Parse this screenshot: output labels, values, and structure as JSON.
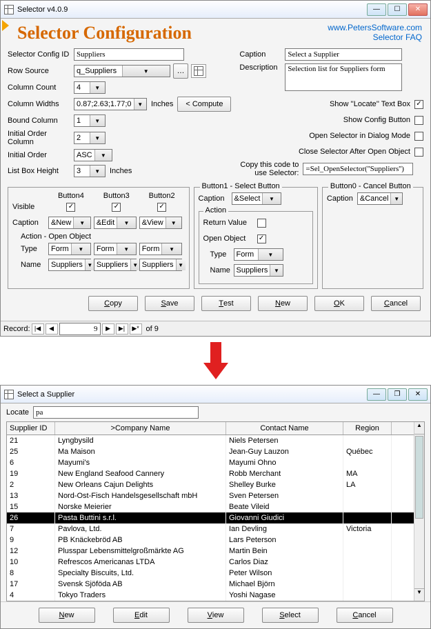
{
  "win1": {
    "title": "Selector v4.0.9",
    "heading": "Selector Configuration",
    "links": {
      "site": "www.PetersSoftware.com",
      "faq": "Selector FAQ"
    },
    "labels": {
      "config_id": "Selector Config ID",
      "row_source": "Row Source",
      "column_count": "Column Count",
      "column_widths": "Column Widths",
      "bound_column": "Bound Column",
      "initial_order_col": "Initial Order Column",
      "initial_order": "Initial Order",
      "list_box_height": "List Box Height",
      "caption": "Caption",
      "description": "Description",
      "inches": "Inches",
      "compute": "< Compute",
      "show_locate": "Show ''Locate'' Text Box",
      "show_config": "Show Config Button",
      "open_dialog": "Open Selector in Dialog Mode",
      "close_after": "Close Selector After Open Object",
      "copy_code": "Copy this code to use Selector:",
      "visible": "Visible",
      "caption2": "Caption",
      "action_open": "Action - Open Object",
      "type": "Type",
      "name": "Name",
      "button4": "Button4",
      "button3": "Button3",
      "button2": "Button2",
      "button1": "Button1 - Select Button",
      "button0": "Button0 - Cancel Button",
      "action": "Action",
      "return_value": "Return Value",
      "open_object": "Open Object"
    },
    "values": {
      "config_id": "Suppliers",
      "row_source": "q_Suppliers",
      "column_count": "4",
      "column_widths": "0.87;2.63;1.77;0",
      "bound_column": "1",
      "initial_order_col": "2",
      "initial_order": "ASC",
      "list_box_height": "3",
      "caption": "Select a Supplier",
      "description": "Selection list for Suppliers form",
      "copy_code": "=Sel_OpenSelector(''Suppliers'')",
      "btn4_caption": "&New",
      "btn3_caption": "&Edit",
      "btn2_caption": "&View",
      "btn1_caption": "&Select",
      "btn0_caption": "&Cancel",
      "type": "Form",
      "name": "Suppliers"
    },
    "checks": {
      "show_locate": true,
      "show_config": false,
      "open_dialog": false,
      "close_after": false,
      "vis4": true,
      "vis3": true,
      "vis2": true,
      "return_value": false,
      "open_object": true
    },
    "actions": {
      "copy": "Copy",
      "save": "Save",
      "test": "Test",
      "new": "New",
      "ok": "OK",
      "cancel": "Cancel"
    },
    "record": {
      "label": "Record:",
      "value": "9",
      "of": "of  9"
    }
  },
  "win2": {
    "title": "Select a Supplier",
    "locate_label": "Locate",
    "locate_value": "pa",
    "columns": {
      "id": "Supplier ID",
      "company": ">Company Name",
      "contact": "Contact Name",
      "region": "Region"
    },
    "rows": [
      {
        "id": "21",
        "company": "Lyngbysild",
        "contact": "Niels Petersen",
        "region": ""
      },
      {
        "id": "25",
        "company": "Ma Maison",
        "contact": "Jean-Guy Lauzon",
        "region": "Québec"
      },
      {
        "id": "6",
        "company": "Mayumi's",
        "contact": "Mayumi Ohno",
        "region": ""
      },
      {
        "id": "19",
        "company": "New England Seafood Cannery",
        "contact": "Robb Merchant",
        "region": "MA"
      },
      {
        "id": "2",
        "company": "New Orleans Cajun Delights",
        "contact": "Shelley Burke",
        "region": "LA"
      },
      {
        "id": "13",
        "company": "Nord-Ost-Fisch Handelsgesellschaft mbH",
        "contact": "Sven Petersen",
        "region": ""
      },
      {
        "id": "15",
        "company": "Norske Meierier",
        "contact": "Beate Vileid",
        "region": ""
      },
      {
        "id": "26",
        "company": "Pasta Buttini s.r.l.",
        "contact": "Giovanni Giudici",
        "region": "",
        "sel": true
      },
      {
        "id": "7",
        "company": "Pavlova, Ltd.",
        "contact": "Ian Devling",
        "region": "Victoria"
      },
      {
        "id": "9",
        "company": "PB Knäckebröd AB",
        "contact": "Lars Peterson",
        "region": ""
      },
      {
        "id": "12",
        "company": "Plusspar Lebensmittelgroßmärkte AG",
        "contact": "Martin Bein",
        "region": ""
      },
      {
        "id": "10",
        "company": "Refrescos Americanas LTDA",
        "contact": "Carlos Diaz",
        "region": ""
      },
      {
        "id": "8",
        "company": "Specialty Biscuits, Ltd.",
        "contact": "Peter Wilson",
        "region": ""
      },
      {
        "id": "17",
        "company": "Svensk Sjöföda AB",
        "contact": "Michael Björn",
        "region": ""
      },
      {
        "id": "4",
        "company": "Tokyo Traders",
        "contact": "Yoshi Nagase",
        "region": ""
      }
    ],
    "buttons": {
      "new": "New",
      "edit": "Edit",
      "view": "View",
      "select": "Select",
      "cancel": "Cancel"
    }
  }
}
